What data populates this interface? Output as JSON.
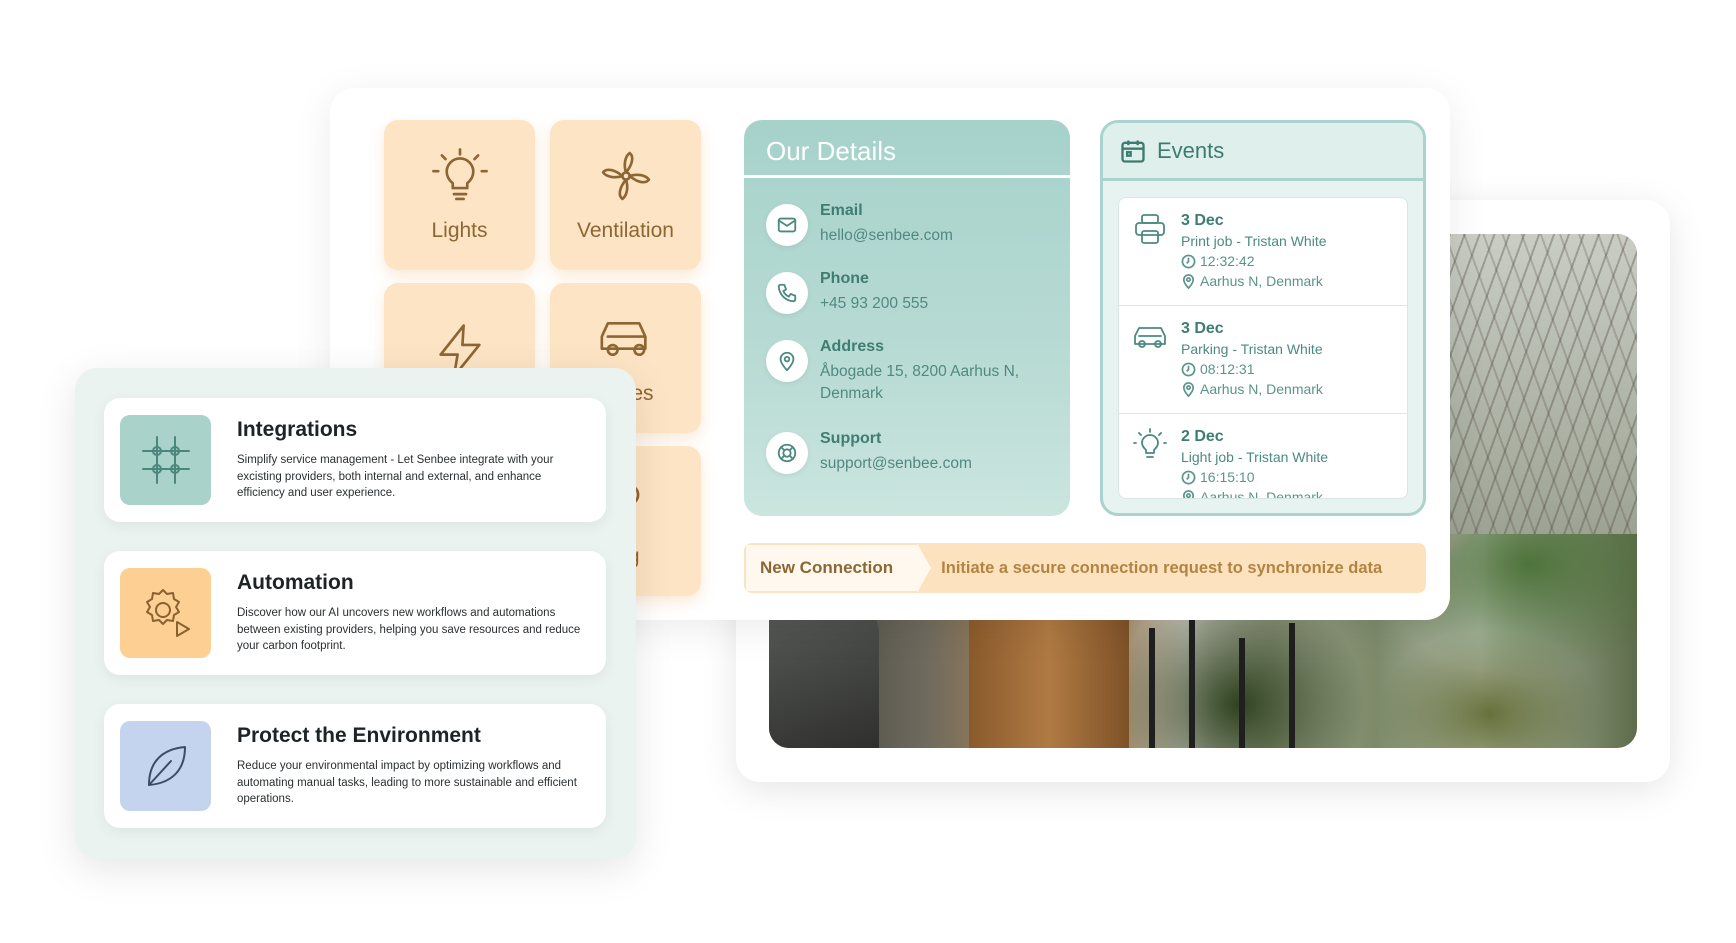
{
  "tiles": [
    {
      "label": "Lights",
      "icon": "lightbulb-icon"
    },
    {
      "label": "Ventilation",
      "icon": "fan-icon"
    },
    {
      "label": "",
      "icon": "lightning-icon"
    },
    {
      "label": "plates",
      "icon": "car-icon"
    },
    {
      "label": "ing",
      "icon": "parking-icon"
    }
  ],
  "details": {
    "title": "Our Details",
    "email": {
      "label": "Email",
      "value": "hello@senbee.com",
      "icon": "mail-icon"
    },
    "phone": {
      "label": "Phone",
      "value": "+45 93 200 555",
      "icon": "phone-icon"
    },
    "address": {
      "label": "Address",
      "value": "Åbogade 15, 8200 Aarhus N, Denmark",
      "icon": "location-pin-icon"
    },
    "support": {
      "label": "Support",
      "value": "support@senbee.com",
      "icon": "lifebuoy-icon"
    }
  },
  "events": {
    "title": "Events",
    "items": [
      {
        "date": "3 Dec",
        "desc": "Print job - Tristan White",
        "time": "12:32:42",
        "location": "Aarhus N, Denmark",
        "icon": "printer-icon"
      },
      {
        "date": "3 Dec",
        "desc": "Parking - Tristan White",
        "time": "08:12:31",
        "location": "Aarhus N, Denmark",
        "icon": "car-icon"
      },
      {
        "date": "2 Dec",
        "desc": "Light job - Tristan White",
        "time": "16:15:10",
        "location": "Aarhus N, Denmark",
        "icon": "lightbulb-icon"
      }
    ]
  },
  "connection": {
    "label": "New Connection",
    "description": "Initiate a secure connection request to synchronize data"
  },
  "features": [
    {
      "title": "Integrations",
      "desc": "Simplify service management - Let Senbee integrate with your excisting providers, both internal and external, and enhance efficiency and user experience.",
      "icon": "grid-network-icon",
      "bg": "#a9d2cb",
      "stroke": "#4a867c"
    },
    {
      "title": "Automation",
      "desc": "Discover how our AI uncovers new workflows and automations between existing providers, helping you save resources and reduce your carbon footprint.",
      "icon": "gear-play-icon",
      "bg": "#fdcf93",
      "stroke": "#8a6230"
    },
    {
      "title": "Protect the Environment",
      "desc": "Reduce your environmental impact by optimizing workflows and automating manual tasks, leading to more sustainable and efficient operations.",
      "icon": "leaf-icon",
      "bg": "#c5d4ee",
      "stroke": "#3c4d63"
    }
  ]
}
